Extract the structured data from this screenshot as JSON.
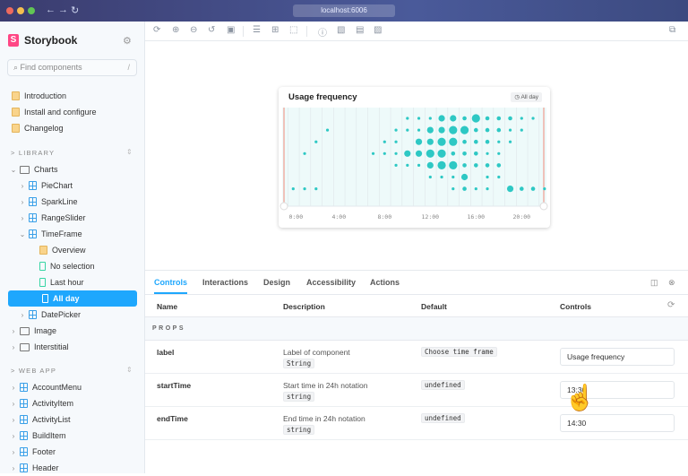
{
  "browser": {
    "url": "localhost:6006",
    "traffic_colors": [
      "#ed6a5e",
      "#f5bf4f",
      "#61c554"
    ]
  },
  "sidebar": {
    "brand": "Storybook",
    "search_placeholder": "Find components",
    "search_shortcut": "/",
    "docs": [
      "Introduction",
      "Install and configure",
      "Changelog"
    ],
    "library_label": "LIBRARY",
    "library": [
      {
        "label": "Charts",
        "type": "folder",
        "expanded": true
      },
      {
        "label": "PieChart",
        "type": "component"
      },
      {
        "label": "SparkLine",
        "type": "component"
      },
      {
        "label": "RangeSlider",
        "type": "component"
      },
      {
        "label": "TimeFrame",
        "type": "component",
        "expanded": true
      },
      {
        "label": "Overview",
        "type": "doc"
      },
      {
        "label": "No selection",
        "type": "story"
      },
      {
        "label": "Last hour",
        "type": "story"
      },
      {
        "label": "All day",
        "type": "story",
        "selected": true
      },
      {
        "label": "DatePicker",
        "type": "component"
      },
      {
        "label": "Image",
        "type": "folder"
      },
      {
        "label": "Interstitial",
        "type": "folder"
      }
    ],
    "webapp_label": "WEB APP",
    "webapp": [
      "AccountMenu",
      "ActivityItem",
      "ActivityList",
      "BuildItem",
      "Footer",
      "Header"
    ]
  },
  "preview": {
    "title": "Usage frequency",
    "range_badge": "All day",
    "accent": "#2ec8c4",
    "ticks": [
      "0:00",
      "4:00",
      "8:00",
      "12:00",
      "16:00",
      "20:00"
    ],
    "dot_rows": [
      [
        [
          10,
          1
        ],
        [
          11,
          1
        ],
        [
          12,
          1
        ],
        [
          13,
          3
        ],
        [
          14,
          3
        ],
        [
          15,
          2
        ],
        [
          16,
          4
        ],
        [
          17,
          2
        ],
        [
          18,
          2
        ],
        [
          19,
          2
        ],
        [
          20,
          1
        ],
        [
          21,
          1
        ]
      ],
      [
        [
          3,
          1
        ],
        [
          9,
          1
        ],
        [
          10,
          1
        ],
        [
          11,
          1
        ],
        [
          12,
          3
        ],
        [
          13,
          3
        ],
        [
          14,
          4
        ],
        [
          15,
          4
        ],
        [
          16,
          2
        ],
        [
          17,
          2
        ],
        [
          18,
          2
        ],
        [
          19,
          1
        ],
        [
          20,
          1
        ]
      ],
      [
        [
          2,
          1
        ],
        [
          8,
          1
        ],
        [
          9,
          1
        ],
        [
          11,
          3
        ],
        [
          12,
          3
        ],
        [
          13,
          4
        ],
        [
          14,
          4
        ],
        [
          15,
          2
        ],
        [
          16,
          2
        ],
        [
          17,
          2
        ],
        [
          18,
          1
        ],
        [
          19,
          1
        ]
      ],
      [
        [
          1,
          1
        ],
        [
          7,
          1
        ],
        [
          8,
          1
        ],
        [
          9,
          1
        ],
        [
          10,
          3
        ],
        [
          11,
          3
        ],
        [
          12,
          4
        ],
        [
          13,
          4
        ],
        [
          14,
          2
        ],
        [
          15,
          2
        ],
        [
          16,
          2
        ],
        [
          17,
          1
        ],
        [
          18,
          1
        ]
      ],
      [
        [
          9,
          1
        ],
        [
          10,
          1
        ],
        [
          11,
          1
        ],
        [
          12,
          3
        ],
        [
          13,
          4
        ],
        [
          14,
          4
        ],
        [
          15,
          2
        ],
        [
          16,
          2
        ],
        [
          17,
          2
        ],
        [
          18,
          2
        ]
      ],
      [
        [
          12,
          1
        ],
        [
          13,
          1
        ],
        [
          14,
          1
        ],
        [
          15,
          3
        ],
        [
          17,
          1
        ],
        [
          18,
          1
        ]
      ],
      [
        [
          0,
          1
        ],
        [
          1,
          1
        ],
        [
          2,
          1
        ],
        [
          14,
          1
        ],
        [
          15,
          2
        ],
        [
          16,
          1
        ],
        [
          17,
          1
        ],
        [
          19,
          3
        ],
        [
          20,
          2
        ],
        [
          21,
          2
        ],
        [
          22,
          1
        ]
      ]
    ]
  },
  "addons": {
    "tabs": [
      "Controls",
      "Interactions",
      "Design",
      "Accessibility",
      "Actions"
    ],
    "columns": [
      "Name",
      "Description",
      "Default",
      "Controls"
    ],
    "section": "PROPS",
    "rows": [
      {
        "name": "label",
        "description": "Label of component",
        "type": "String",
        "default": "Choose time frame",
        "value": "Usage frequency"
      },
      {
        "name": "startTime",
        "description": "Start time in 24h notation",
        "type": "string",
        "default": "undefined",
        "value": "13:30"
      },
      {
        "name": "endTime",
        "description": "End time in 24h notation",
        "type": "string",
        "default": "undefined",
        "value": "14:30"
      }
    ]
  }
}
